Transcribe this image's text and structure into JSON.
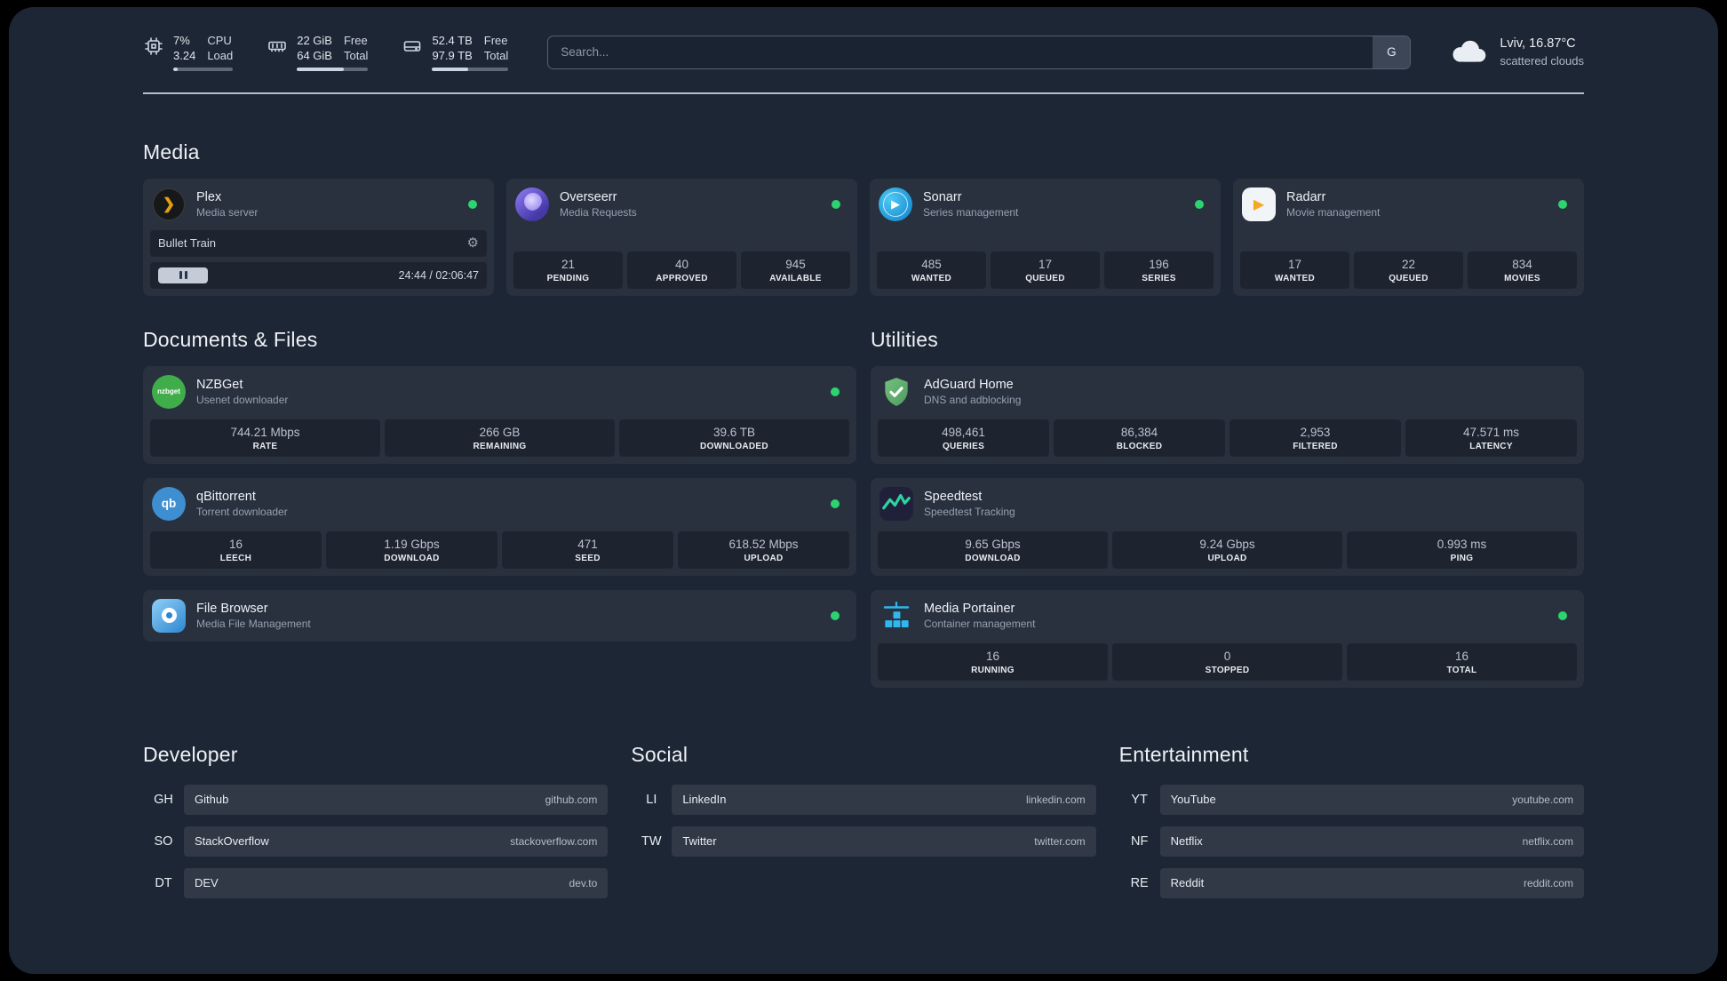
{
  "topbar": {
    "cpu": {
      "value1": "7%",
      "value2": "3.24",
      "label1": "CPU",
      "label2": "Load",
      "bar_percent": 7
    },
    "ram": {
      "value1": "22 GiB",
      "value2": "64 GiB",
      "label1": "Free",
      "label2": "Total",
      "bar_percent": 66
    },
    "disk": {
      "value1": "52.4 TB",
      "value2": "97.9 TB",
      "label1": "Free",
      "label2": "Total",
      "bar_percent": 47
    },
    "search": {
      "placeholder": "Search...",
      "button_label": "G"
    },
    "weather": {
      "location": "Lviv, 16.87°C",
      "condition": "scattered clouds"
    }
  },
  "icons": {
    "gear": "⚙",
    "play": "▶",
    "plex_chevron": "❯"
  },
  "colors": {
    "background": "#1d2634",
    "status_online": "#2dd36f",
    "plex_gold": "#e5a00d",
    "overseerr_purple": "#6a57d5",
    "sonarr_blue": "#35b8ef",
    "radarr_amber": "#f6a723",
    "nzbget_green": "#3fae4a",
    "qbittorrent_blue": "#3d8fd1",
    "filebrowser_blue": "#2e86cf",
    "adguard_green": "#67b279",
    "speedtest_green": "#2ed3a0",
    "portainer_blue": "#2fb8f0"
  },
  "sections": {
    "media": {
      "title": "Media",
      "plex": {
        "name": "Plex",
        "subtitle": "Media server",
        "status": "online",
        "now_playing": "Bullet Train",
        "elapsed_total": "24:44 / 02:06:47"
      },
      "overseerr": {
        "name": "Overseerr",
        "subtitle": "Media Requests",
        "status": "online",
        "stats": [
          {
            "value": "21",
            "label": "PENDING"
          },
          {
            "value": "40",
            "label": "APPROVED"
          },
          {
            "value": "945",
            "label": "AVAILABLE"
          }
        ]
      },
      "sonarr": {
        "name": "Sonarr",
        "subtitle": "Series management",
        "status": "online",
        "stats": [
          {
            "value": "485",
            "label": "WANTED"
          },
          {
            "value": "17",
            "label": "QUEUED"
          },
          {
            "value": "196",
            "label": "SERIES"
          }
        ]
      },
      "radarr": {
        "name": "Radarr",
        "subtitle": "Movie management",
        "status": "online",
        "stats": [
          {
            "value": "17",
            "label": "WANTED"
          },
          {
            "value": "22",
            "label": "QUEUED"
          },
          {
            "value": "834",
            "label": "MOVIES"
          }
        ]
      }
    },
    "documents": {
      "title": "Documents & Files",
      "nzbget": {
        "name": "NZBGet",
        "subtitle": "Usenet downloader",
        "status": "online",
        "icon_text": "nzbget",
        "stats": [
          {
            "value": "744.21 Mbps",
            "label": "RATE"
          },
          {
            "value": "266 GB",
            "label": "REMAINING"
          },
          {
            "value": "39.6 TB",
            "label": "DOWNLOADED"
          }
        ]
      },
      "qbittorrent": {
        "name": "qBittorrent",
        "subtitle": "Torrent downloader",
        "status": "online",
        "icon_text": "qb",
        "stats": [
          {
            "value": "16",
            "label": "LEECH"
          },
          {
            "value": "1.19 Gbps",
            "label": "DOWNLOAD"
          },
          {
            "value": "471",
            "label": "SEED"
          },
          {
            "value": "618.52 Mbps",
            "label": "UPLOAD"
          }
        ]
      },
      "filebrowser": {
        "name": "File Browser",
        "subtitle": "Media File Management",
        "status": "online"
      }
    },
    "utilities": {
      "title": "Utilities",
      "adguard": {
        "name": "AdGuard Home",
        "subtitle": "DNS and adblocking",
        "stats": [
          {
            "value": "498,461",
            "label": "QUERIES"
          },
          {
            "value": "86,384",
            "label": "BLOCKED"
          },
          {
            "value": "2,953",
            "label": "FILTERED"
          },
          {
            "value": "47.571 ms",
            "label": "LATENCY"
          }
        ]
      },
      "speedtest": {
        "name": "Speedtest",
        "subtitle": "Speedtest Tracking",
        "stats": [
          {
            "value": "9.65 Gbps",
            "label": "DOWNLOAD"
          },
          {
            "value": "9.24 Gbps",
            "label": "UPLOAD"
          },
          {
            "value": "0.993 ms",
            "label": "PING"
          }
        ]
      },
      "portainer": {
        "name": "Media Portainer",
        "subtitle": "Container management",
        "status": "online",
        "stats": [
          {
            "value": "16",
            "label": "RUNNING"
          },
          {
            "value": "0",
            "label": "STOPPED"
          },
          {
            "value": "16",
            "label": "TOTAL"
          }
        ]
      }
    }
  },
  "bookmarks": {
    "developer": {
      "title": "Developer",
      "items": [
        {
          "abbr": "GH",
          "name": "Github",
          "url": "github.com"
        },
        {
          "abbr": "SO",
          "name": "StackOverflow",
          "url": "stackoverflow.com"
        },
        {
          "abbr": "DT",
          "name": "DEV",
          "url": "dev.to"
        }
      ]
    },
    "social": {
      "title": "Social",
      "items": [
        {
          "abbr": "LI",
          "name": "LinkedIn",
          "url": "linkedin.com"
        },
        {
          "abbr": "TW",
          "name": "Twitter",
          "url": "twitter.com"
        }
      ]
    },
    "entertainment": {
      "title": "Entertainment",
      "items": [
        {
          "abbr": "YT",
          "name": "YouTube",
          "url": "youtube.com"
        },
        {
          "abbr": "NF",
          "name": "Netflix",
          "url": "netflix.com"
        },
        {
          "abbr": "RE",
          "name": "Reddit",
          "url": "reddit.com"
        }
      ]
    }
  }
}
